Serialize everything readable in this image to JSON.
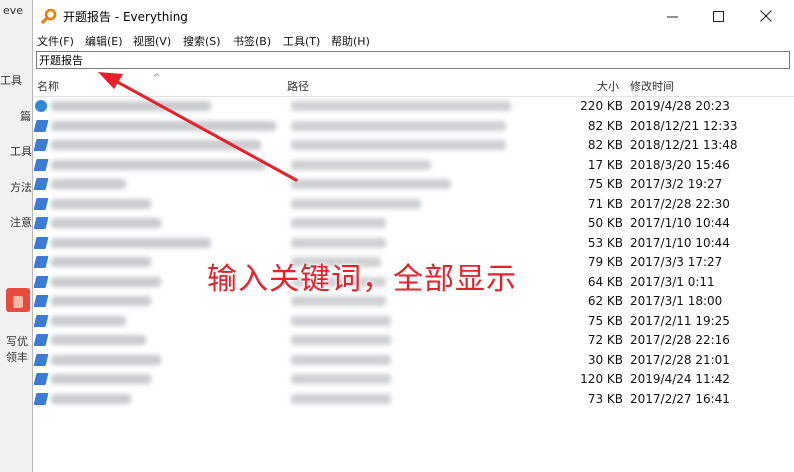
{
  "window": {
    "title": "开题报告 - Everything"
  },
  "menu": [
    "文件(F)",
    "编辑(E)",
    "视图(V)",
    "搜索(S)",
    "书签(B)",
    "工具(T)",
    "帮助(H)"
  ],
  "search": {
    "value": "开题报告"
  },
  "columns": {
    "name": "名称",
    "path": "路径",
    "size": "大小",
    "modified": "修改时间"
  },
  "rows": [
    {
      "size": "220 KB",
      "modified": "2019/4/28 20:23"
    },
    {
      "size": "82 KB",
      "modified": "2018/12/21 12:33"
    },
    {
      "size": "82 KB",
      "modified": "2018/12/21 13:48"
    },
    {
      "size": "17 KB",
      "modified": "2018/3/20 15:46"
    },
    {
      "size": "75 KB",
      "modified": "2017/3/2 19:27"
    },
    {
      "size": "71 KB",
      "modified": "2017/2/28 22:30"
    },
    {
      "size": "50 KB",
      "modified": "2017/1/10 10:44"
    },
    {
      "size": "53 KB",
      "modified": "2017/1/10 10:44"
    },
    {
      "size": "79 KB",
      "modified": "2017/3/3 17:27"
    },
    {
      "size": "64 KB",
      "modified": "2017/3/1 0:11"
    },
    {
      "size": "62 KB",
      "modified": "2017/3/1 18:00"
    },
    {
      "size": "75 KB",
      "modified": "2017/2/11 19:25"
    },
    {
      "size": "72 KB",
      "modified": "2017/2/28 22:16"
    },
    {
      "size": "30 KB",
      "modified": "2017/2/28 21:01"
    },
    {
      "size": "120 KB",
      "modified": "2019/4/24 11:42"
    },
    {
      "size": "73 KB",
      "modified": "2017/2/27 16:41"
    }
  ],
  "annotation": "输入关键词，全部显示",
  "background_app": {
    "labels": [
      "eve",
      "工具",
      "篇",
      "工具",
      "方法",
      "注意",
      "写优",
      "领丰"
    ]
  },
  "colors": {
    "annotation": "#e8202a",
    "file_icon": "#3a7bd5"
  }
}
